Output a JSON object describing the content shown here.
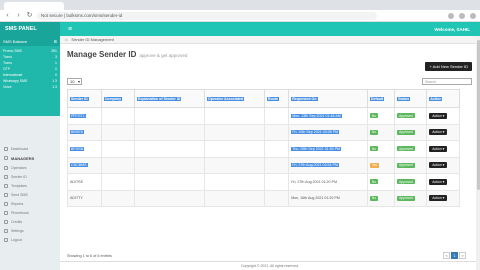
{
  "browser": {
    "url": "Not secure | bulksms.com/sms/sender-id"
  },
  "header": {
    "brand": "SMS PANEL",
    "welcome": "Welcome, SAHIL"
  },
  "sidebar": {
    "balance_label": "SMS Balance",
    "balances": [
      {
        "name": "Promo SMS",
        "value": "281"
      },
      {
        "name": "Trans",
        "value": "3"
      },
      {
        "name": "Trans",
        "value": "1"
      },
      {
        "name": "OTP",
        "value": "0"
      },
      {
        "name": "International",
        "value": "0"
      },
      {
        "name": "Whatsapp SMS",
        "value": "1.3"
      },
      {
        "name": "Voice",
        "value": "1.3"
      }
    ],
    "menu": [
      {
        "label": "Dashboard",
        "section": false
      },
      {
        "label": "MANAGERS",
        "section": true
      },
      {
        "label": "Operators",
        "section": false
      },
      {
        "label": "Sender ID",
        "section": false
      },
      {
        "label": "Templates",
        "section": false
      },
      {
        "label": "Send SMS",
        "section": false
      },
      {
        "label": "Reports",
        "section": false
      },
      {
        "label": "Phonebook",
        "section": false
      },
      {
        "label": "Credits",
        "section": false
      },
      {
        "label": "Settings",
        "section": false
      },
      {
        "label": "Logout",
        "section": false
      }
    ]
  },
  "breadcrumb": {
    "item": "Sender ID Management"
  },
  "page": {
    "title": "Manage Sender ID",
    "subtitle": "approve & get approved",
    "add_button": "+ Add New Sender ID",
    "page_size": "10",
    "search_placeholder": "Search"
  },
  "table": {
    "headers": [
      "Sender ID",
      "Company",
      "Explanation of Sender ID",
      "Operator Associated",
      "Route",
      "Requested On",
      "Default",
      "Status",
      "Action"
    ],
    "rows": [
      {
        "id": "PRTSTL",
        "date": "Mon, 13th Sep 2021 01:48 AM",
        "default": "No",
        "status": "Approved",
        "highlight": true
      },
      {
        "id": "BNSEK",
        "date": "Fri, 10th Sep 2021 03:06 PM",
        "default": "No",
        "status": "Approved",
        "highlight": true
      },
      {
        "id": "BFGSN",
        "date": "Thu, 09th Sep 2021 01:50 PM",
        "default": "No",
        "status": "Approved",
        "highlight": true
      },
      {
        "id": "CDCBMS",
        "date": "Fri, 27th Aug 2021 03:54 PM",
        "default": "Yes",
        "status": "Approved",
        "highlight": true
      },
      {
        "id": "ADITSE",
        "date": "Fri, 27th Aug 2021 01:20 PM",
        "default": "No",
        "status": "Approved",
        "highlight": false
      },
      {
        "id": "ADITTY",
        "date": "Mon, 16th Aug 2021 01:20 PM",
        "default": "No",
        "status": "Approved",
        "highlight": false
      }
    ],
    "action_label": "Action"
  },
  "footer": {
    "info": "Showing 1 to 6 of 6 entries",
    "pages": [
      "<",
      "1",
      ">"
    ],
    "copyright": "Copyright © 2021. All rights reserved."
  }
}
